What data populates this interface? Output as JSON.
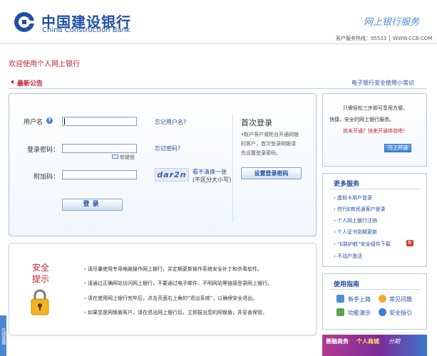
{
  "header": {
    "logo_cn": "中国建设银行",
    "logo_en": "China Construction Bank",
    "title": "网上银行服务",
    "hotline": "客户服务热线：95533 │ WWW.CCB.COM"
  },
  "welcome": "欢迎使用个人网上银行",
  "notice": {
    "label": "最新公告",
    "safety_link": "电子银行安全使用小常识"
  },
  "login": {
    "username_label": "用户名",
    "username_value": "",
    "forgot_username": "忘记用户名?",
    "password_label": "登录密码：",
    "forgot_password": "忘记密码?",
    "soft_keyboard": "软键盘",
    "code_label": "附加码：",
    "captcha_text": "dar2n",
    "refresh_link": "看不清换一张",
    "case_note": "(不区分大小写)",
    "login_button": "登录"
  },
  "first_login": {
    "title": "首次登录",
    "lines": [
      "•账户客户或柜台开通网银",
      "的客户，首次登录网银请",
      "先设置登录密码。"
    ],
    "button": "设置登录密码"
  },
  "security_tips": {
    "title_line1": "安全",
    "title_line2": "提示",
    "tips": [
      "› 请尽量使用专用电脑操作网上银行，并定期更新操作系统安全补丁和杀毒软件。",
      "› 请通过正确网站访问网上银行，不要通过电子邮件、不明网站等链接登录网上银行。",
      "› 请在使用网上银行完毕后，点击页面右上角的“退出系统”，以确保安全退出。",
      "› 如果您是网银盾客户，请在退出网上银行后，立即拔出您的网银盾，并妥善保管。"
    ]
  },
  "open_box": {
    "line1": "只需轻松三步即可享用方便、",
    "line2": "快捷、安全的网上银行服务。",
    "cta": "尚未开通？快来开通体验吧！",
    "button": "马上开通"
  },
  "more_services": {
    "title": "更多服务",
    "items": [
      "› 虚拟卡用户登录",
      "› 信行E商贸通客户登录",
      "› 个人网上银行注销",
      "› 个人证书到期更新",
      "› “E路护航”安全组件下载",
      "› 不动户激活"
    ],
    "badge": "新"
  },
  "guide": {
    "title": "使用指南",
    "items": [
      "新手上路",
      "常见问题",
      "功能演示",
      "安全指引"
    ]
  },
  "banner": {
    "text_a": "善融商务",
    "text_b": "个人商城",
    "text_c": "分期"
  },
  "side_tab": "在线客服"
}
